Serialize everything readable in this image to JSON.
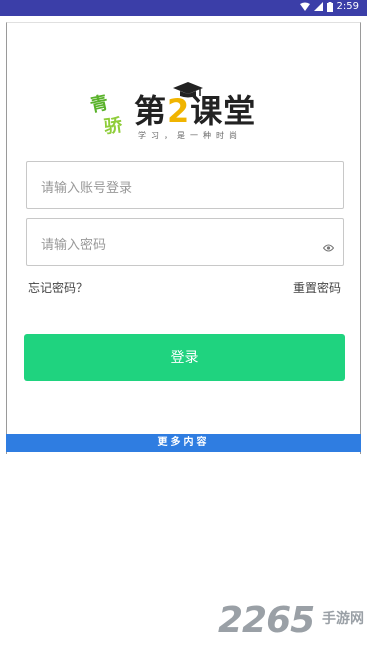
{
  "status_bar": {
    "time": "2:59"
  },
  "logo": {
    "mark_char_1": "青",
    "mark_char_2": "骄",
    "title_prefix": "第",
    "title_number": "2",
    "title_suffix": "课堂",
    "slogan": "学习，是一种时尚"
  },
  "form": {
    "account_placeholder": "请输入账号登录",
    "password_placeholder": "请输入密码",
    "forgot_link": "忘记密码？",
    "reset_link": "重置密码",
    "login_button": "登录"
  },
  "more_bar": {
    "label": "更多内容"
  },
  "watermark": {
    "number": "2265",
    "suffix": "手游网"
  },
  "colors": {
    "status_bar": "#3b3ea8",
    "login_button": "#1fd37f",
    "more_bar": "#2f7de1",
    "accent_yellow": "#f0b400"
  },
  "icons": [
    "wifi-icon",
    "signal-icon",
    "battery-icon",
    "graduation-cap-icon",
    "eye-icon"
  ]
}
